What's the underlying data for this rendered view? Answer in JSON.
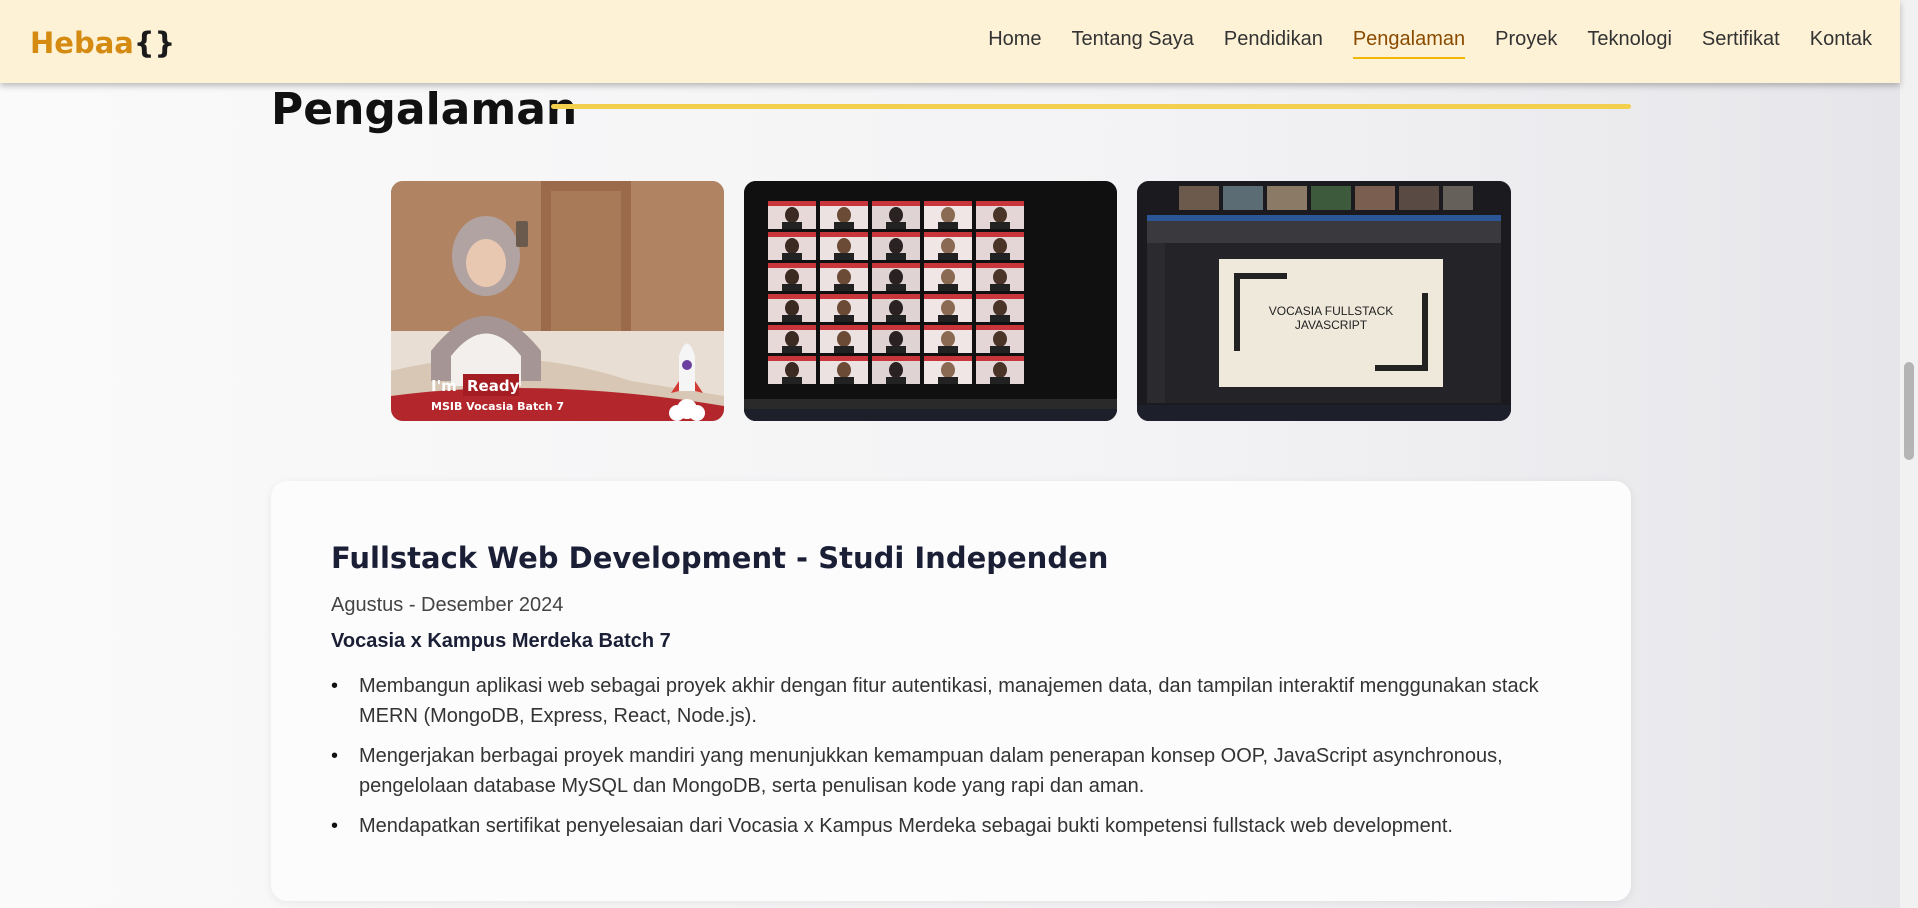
{
  "brand": {
    "name": "Hebaa",
    "suffix": "{}"
  },
  "nav": {
    "items": [
      {
        "label": "Home"
      },
      {
        "label": "Tentang Saya"
      },
      {
        "label": "Pendidikan"
      },
      {
        "label": "Pengalaman",
        "active": true
      },
      {
        "label": "Proyek"
      },
      {
        "label": "Teknologi"
      },
      {
        "label": "Sertifikat"
      },
      {
        "label": "Kontak"
      }
    ]
  },
  "section": {
    "title": "Pengalaman"
  },
  "gallery": {
    "photo1": {
      "caption_im": "I'm",
      "caption_ready": "Ready",
      "caption_line2": "MSIB Vocasia Batch 7"
    },
    "photo3": {
      "slide_line1": "VOCASIA FULLSTACK",
      "slide_line2": "JAVASCRIPT"
    }
  },
  "experience": {
    "title": "Fullstack Web Development - Studi Independen",
    "date": "Agustus - Desember 2024",
    "organization": "Vocasia x Kampus Merdeka Batch 7",
    "bullets": [
      "Membangun aplikasi web sebagai proyek akhir dengan fitur autentikasi, manajemen data, dan tampilan interaktif menggunakan stack MERN (MongoDB, Express, React, Node.js).",
      "Mengerjakan berbagai proyek mandiri yang menunjukkan kemampuan dalam penerapan konsep OOP, JavaScript asynchronous, pengelolaan database MySQL dan MongoDB, serta penulisan kode yang rapi dan aman.",
      "Mendapatkan sertifikat penyelesaian dari Vocasia x Kampus Merdeka sebagai bukti kompetensi fullstack web development."
    ]
  },
  "colors": {
    "accent": "#f2cf4d",
    "brand": "#d58a12",
    "navbar_bg": "#fdf2d6"
  }
}
